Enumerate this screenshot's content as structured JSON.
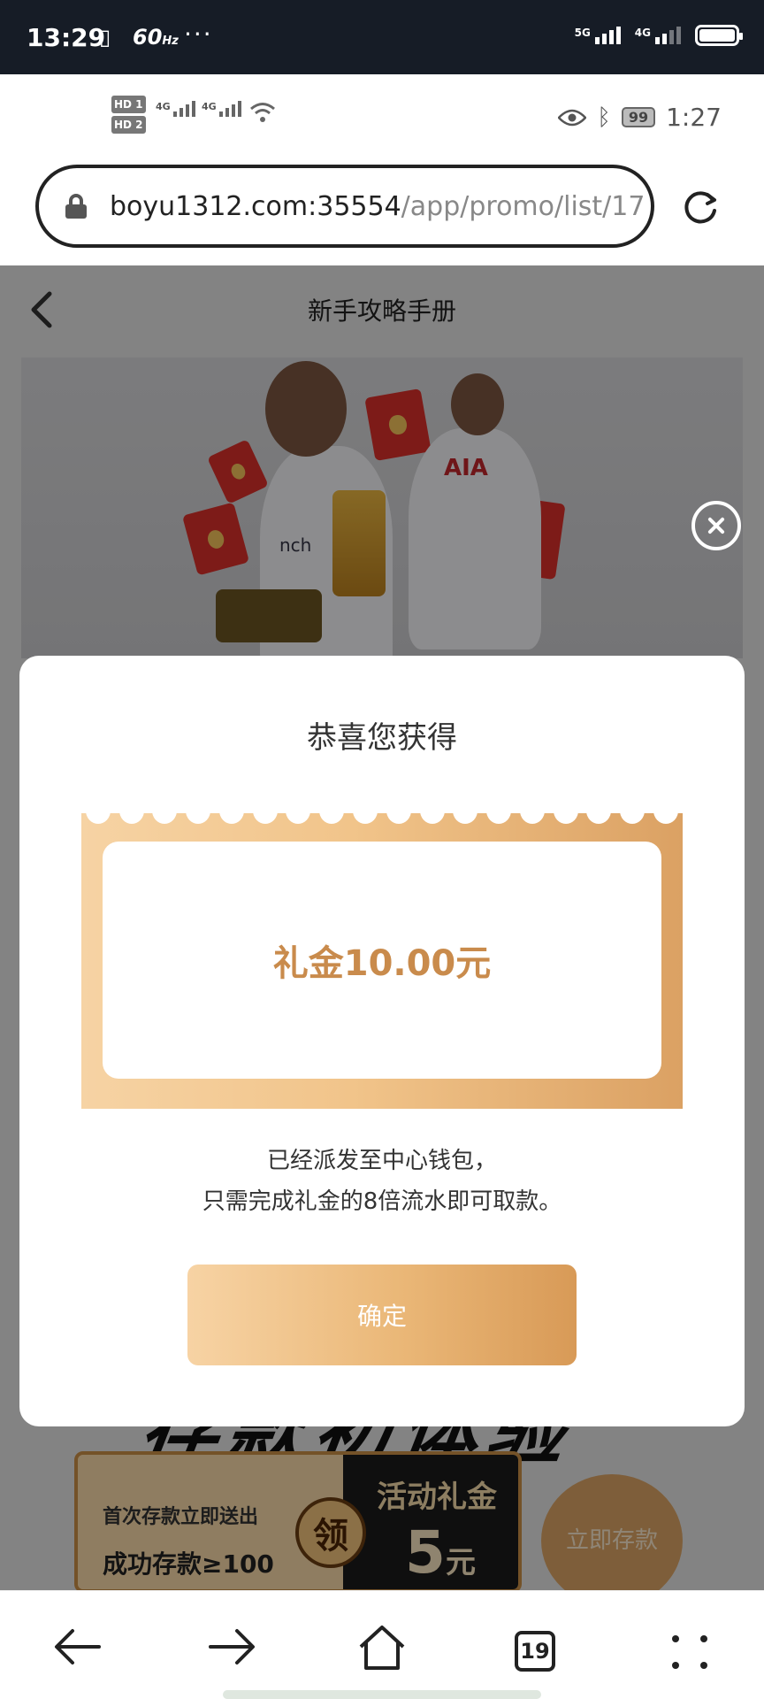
{
  "device_status": {
    "time": "13:29",
    "refresh_rate": "60",
    "refresh_unit": "Hz",
    "net1": "5G",
    "net2": "4G",
    "more": "···"
  },
  "captured_status": {
    "hd1": "HD 1",
    "hd2": "HD 2",
    "net_a": "4G",
    "net_b": "4G",
    "battery": "99",
    "time": "1:27"
  },
  "browser": {
    "url_host": "boyu1312.com:35554",
    "url_path": "/app/promo/list/17"
  },
  "app": {
    "title": "新手攻略手册"
  },
  "banner": {
    "jersey_text_1": "AIA",
    "jersey_text_2": "nch"
  },
  "promo": {
    "big_title": "存款初体验",
    "coupon_line1": "首次存款立即送出",
    "coupon_line2": "成功存款≥100",
    "coupon_ling": "领",
    "coupon_title": "活动礼金",
    "coupon_amount": "5",
    "coupon_unit": "元",
    "deposit_button": "立即存款"
  },
  "modal": {
    "title": "恭喜您获得",
    "reward": "礼金10.00元",
    "desc_line1": "已经派发至中心钱包，",
    "desc_line2": "只需完成礼金的8倍流水即可取款。",
    "confirm": "确定"
  },
  "bottom_nav": {
    "tab_count": "19"
  }
}
